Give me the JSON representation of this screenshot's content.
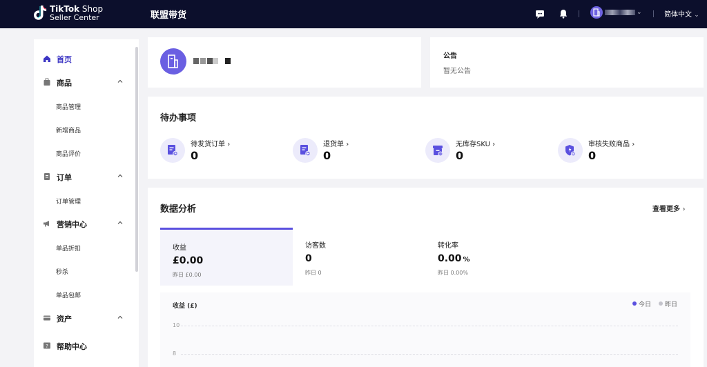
{
  "topbar": {
    "logo_line1_bold": "TikTok",
    "logo_line1_rest": " Shop",
    "logo_line2": "Seller Center",
    "title": "联盟带货",
    "language": "简体中文",
    "icons": [
      "chat-icon",
      "bell-icon",
      "user-avatar",
      "chevron-down-icon"
    ]
  },
  "sidebar": {
    "items": [
      {
        "label": "首页",
        "icon": "home-icon",
        "active": true
      },
      {
        "label": "商品",
        "icon": "bag-icon",
        "expanded": true,
        "children": [
          "商品管理",
          "新增商品",
          "商品评价"
        ]
      },
      {
        "label": "订单",
        "icon": "order-icon",
        "expanded": true,
        "children": [
          "订单管理"
        ]
      },
      {
        "label": "营销中心",
        "icon": "megaphone-icon",
        "expanded": true,
        "children": [
          "单品折扣",
          "秒杀",
          "单品包邮"
        ]
      },
      {
        "label": "资产",
        "icon": "card-icon",
        "expanded": true,
        "children": []
      },
      {
        "label": "帮助中心",
        "icon": "help-icon",
        "children": []
      }
    ]
  },
  "announcement": {
    "title": "公告",
    "text": "暂无公告"
  },
  "todo": {
    "title": "待办事项",
    "items": [
      {
        "label": "待发货订单",
        "value": "0",
        "icon": "pending-shipment-icon"
      },
      {
        "label": "退货单",
        "value": "0",
        "icon": "return-icon"
      },
      {
        "label": "无库存SKU",
        "value": "0",
        "icon": "out-of-stock-icon"
      },
      {
        "label": "审核失败商品",
        "value": "0",
        "icon": "review-failed-icon"
      }
    ]
  },
  "analytics": {
    "title": "数据分析",
    "more_label": "查看更多",
    "metrics": [
      {
        "label": "收益",
        "value": "£0.00",
        "unit": "",
        "prev": "昨日 £0.00",
        "selected": true
      },
      {
        "label": "访客数",
        "value": "0",
        "unit": "",
        "prev": "昨日 0",
        "selected": false
      },
      {
        "label": "转化率",
        "value": "0.00",
        "unit": "%",
        "prev": "昨日 0.00%",
        "selected": false
      }
    ],
    "chart": {
      "title": "收益 (£)",
      "legend": [
        {
          "label": "今日",
          "color": "#5a50df"
        },
        {
          "label": "昨日",
          "color": "#c4c4cc"
        }
      ],
      "y_ticks": [
        "10",
        "8"
      ]
    }
  },
  "colors": {
    "brand": "#5a50df",
    "topbar": "#0c0f2c",
    "active_nav": "#3d36c4"
  }
}
